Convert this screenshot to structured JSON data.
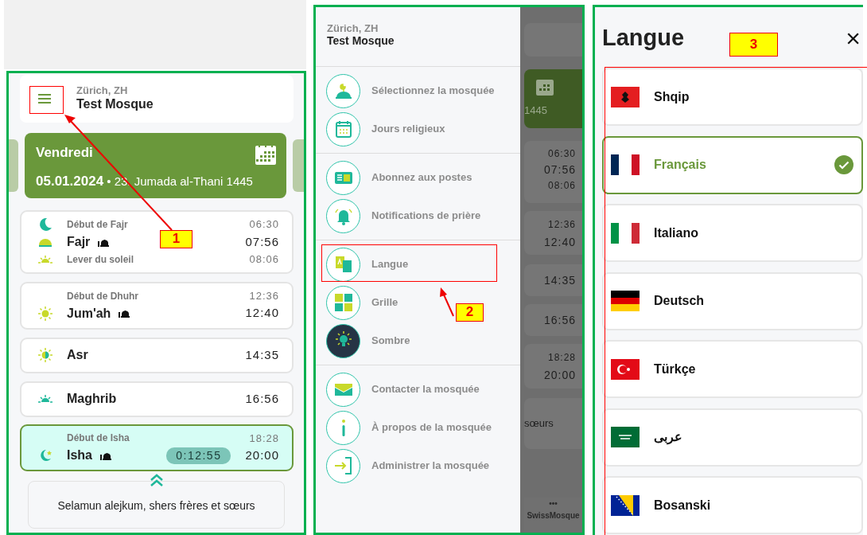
{
  "home_screen": {
    "header": {
      "location": "Zürich, ZH",
      "mosque": "Test Mosque"
    },
    "date_card": {
      "weekday": "Vendredi",
      "date": "05.01.2024",
      "hijri": " • 23. Jumada al-Thani 1445"
    },
    "prayers": [
      {
        "start_label": "Début de Fajr",
        "start_time": "06:30",
        "name": "Fajr",
        "time": "07:56",
        "jamaah": true,
        "sub_label": "Lever du soleil",
        "sub_time": "08:06",
        "selected": false
      },
      {
        "start_label": "Début de Dhuhr",
        "start_time": "12:36",
        "name": "Jum'ah",
        "time": "12:40",
        "jamaah": true,
        "selected": false
      },
      {
        "name": "Asr",
        "time": "14:35",
        "jamaah": false,
        "selected": false
      },
      {
        "name": "Maghrib",
        "time": "16:56",
        "jamaah": false,
        "selected": false
      },
      {
        "start_label": "Début de Isha",
        "start_time": "18:28",
        "name": "Isha",
        "time": "20:00",
        "jamaah": true,
        "countdown": "0:12:55",
        "selected": true
      }
    ],
    "message": "Selamun alejkum, shers frères et sœurs"
  },
  "menu_screen": {
    "header": {
      "location": "Zürich, ZH",
      "mosque": "Test Mosque"
    },
    "sections": [
      [
        {
          "label": "Sélectionnez la mosquée"
        },
        {
          "label": "Jours religieux"
        }
      ],
      [
        {
          "label": "Abonnez aux postes"
        },
        {
          "label": "Notifications de prière"
        }
      ],
      [
        {
          "label": "Langue"
        },
        {
          "label": "Grille"
        },
        {
          "label": "Sombre"
        }
      ],
      [
        {
          "label": "Contacter la mosquée"
        },
        {
          "label": "À propos de la mosquée"
        },
        {
          "label": "Administrer la mosquée"
        }
      ]
    ],
    "background": {
      "hijri_year": "1445",
      "times": [
        [
          "06:30",
          "07:56",
          "08:06"
        ],
        [
          "12:36",
          "12:40"
        ],
        [
          "14:35"
        ],
        [
          "16:56"
        ],
        [
          "18:28",
          "20:00"
        ]
      ],
      "message": "sœurs",
      "tab_label": "SwissMosque",
      "tab_icon": "•••"
    }
  },
  "language_screen": {
    "title": "Langue",
    "close": "×",
    "languages": [
      {
        "name": "Shqip",
        "selected": false
      },
      {
        "name": "Français",
        "selected": true
      },
      {
        "name": "Italiano",
        "selected": false
      },
      {
        "name": "Deutsch",
        "selected": false
      },
      {
        "name": "Türkçe",
        "selected": false
      },
      {
        "name": "عربى",
        "selected": false
      },
      {
        "name": "Bosanski",
        "selected": false
      }
    ]
  },
  "annotations": [
    {
      "label": "1"
    },
    {
      "label": "2"
    },
    {
      "label": "3"
    }
  ]
}
